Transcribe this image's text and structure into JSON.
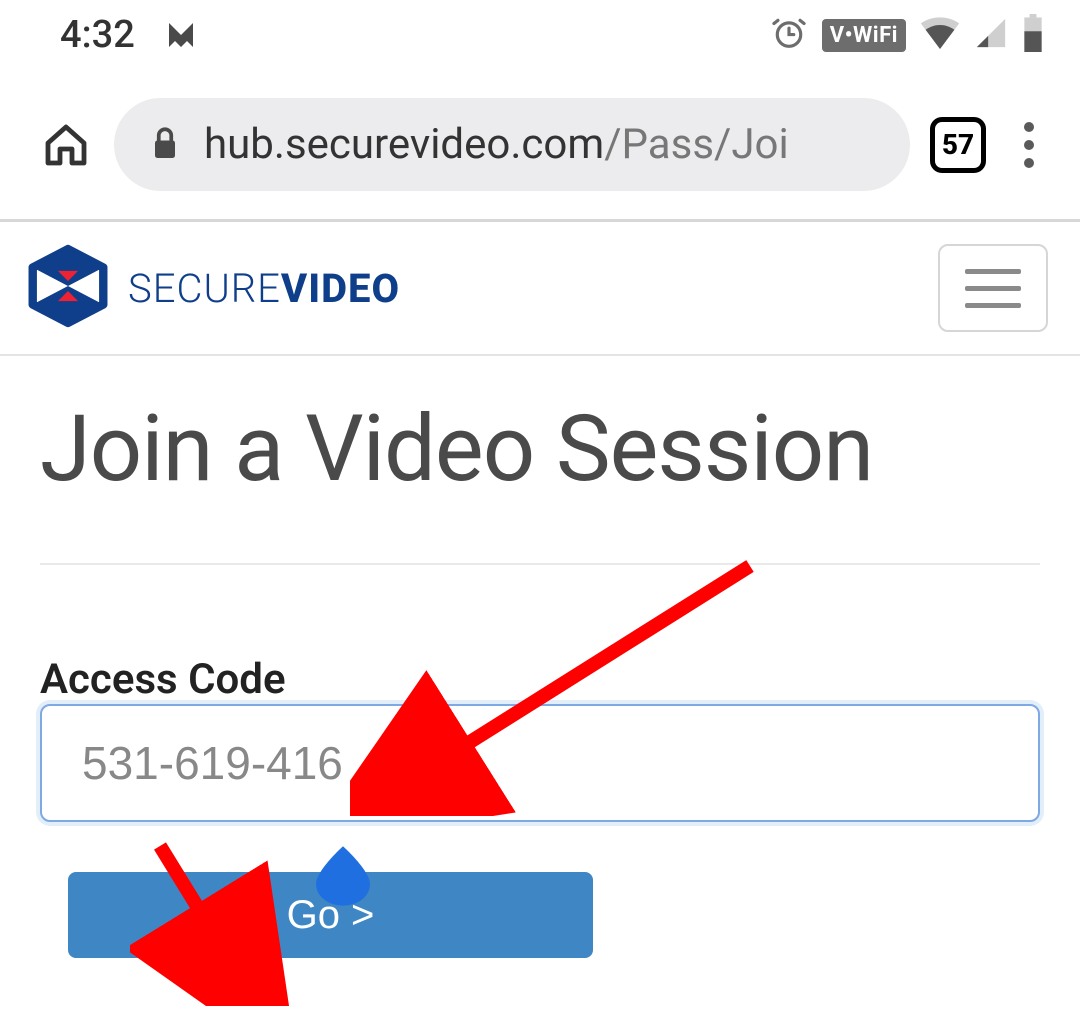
{
  "status_bar": {
    "time": "4:32",
    "vowifi_label": "V•WiFi"
  },
  "browser": {
    "url_host": "hub.securevideo.com",
    "url_path": "/Pass/Joi",
    "tab_count": "57"
  },
  "header": {
    "brand_light": "SECURE",
    "brand_bold": "VIDEO"
  },
  "page": {
    "title": "Join a Video Session",
    "access_label": "Access Code",
    "access_value": "531-619-416",
    "go_label": "Go >"
  }
}
